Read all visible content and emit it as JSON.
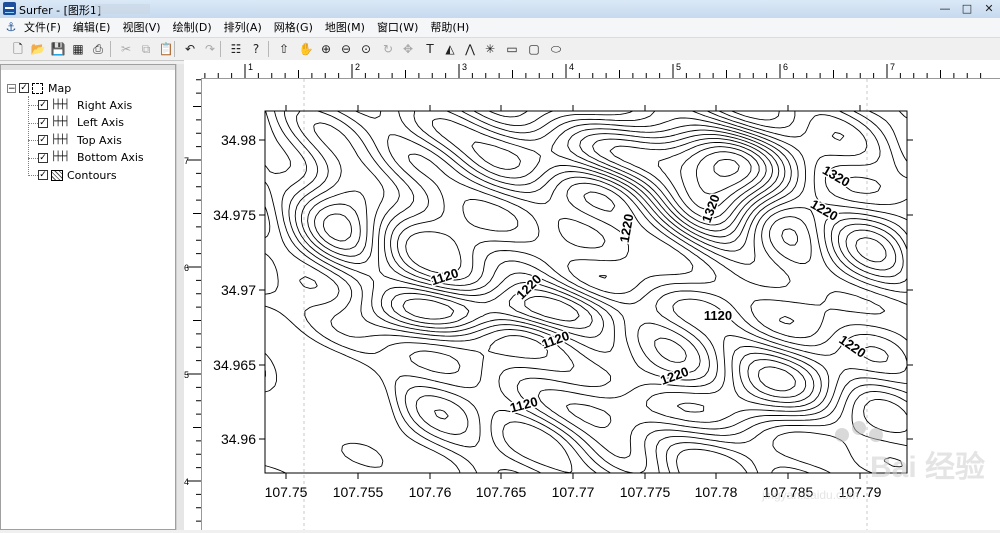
{
  "window": {
    "title": "Surfer - [图形1]"
  },
  "window_controls": {
    "minimize": "—",
    "maximize": "□",
    "close": "✕"
  },
  "menu": {
    "items": [
      {
        "label": "文件(F)"
      },
      {
        "label": "编辑(E)"
      },
      {
        "label": "视图(V)"
      },
      {
        "label": "绘制(D)"
      },
      {
        "label": "排列(A)"
      },
      {
        "label": "网格(G)"
      },
      {
        "label": "地图(M)"
      },
      {
        "label": "窗口(W)"
      },
      {
        "label": "帮助(H)"
      }
    ]
  },
  "toolbar": {
    "buttons": [
      {
        "name": "new-icon",
        "glyph": "🗋",
        "enabled": true
      },
      {
        "name": "open-icon",
        "glyph": "📂",
        "enabled": true
      },
      {
        "name": "save-icon",
        "glyph": "💾",
        "enabled": true
      },
      {
        "name": "worksheet-icon",
        "glyph": "▦",
        "enabled": true
      },
      {
        "name": "print-icon",
        "glyph": "⎙",
        "enabled": true
      },
      {
        "name": "cut-icon",
        "glyph": "✂",
        "enabled": false
      },
      {
        "name": "copy-icon",
        "glyph": "⧉",
        "enabled": false
      },
      {
        "name": "paste-icon",
        "glyph": "📋",
        "enabled": true
      },
      {
        "name": "undo-icon",
        "glyph": "↶",
        "enabled": true
      },
      {
        "name": "redo-icon",
        "glyph": "↷",
        "enabled": false
      },
      {
        "name": "object-manager-icon",
        "glyph": "☷",
        "enabled": true
      },
      {
        "name": "help-pointer-icon",
        "glyph": "?",
        "enabled": true
      },
      {
        "name": "select-arrow-icon",
        "glyph": "⇧",
        "enabled": true
      },
      {
        "name": "pan-hand-icon",
        "glyph": "✋",
        "enabled": true
      },
      {
        "name": "zoom-in-icon",
        "glyph": "⊕",
        "enabled": true
      },
      {
        "name": "zoom-out-icon",
        "glyph": "⊖",
        "enabled": true
      },
      {
        "name": "zoom-fit-icon",
        "glyph": "⊙",
        "enabled": true
      },
      {
        "name": "rotate-icon",
        "glyph": "↻",
        "enabled": false
      },
      {
        "name": "reshape-icon",
        "glyph": "✥",
        "enabled": false
      },
      {
        "name": "text-tool-icon",
        "glyph": "T",
        "enabled": true
      },
      {
        "name": "polygon-tool-icon",
        "glyph": "◭",
        "enabled": true
      },
      {
        "name": "polyline-tool-icon",
        "glyph": "⋀",
        "enabled": true
      },
      {
        "name": "symbol-tool-icon",
        "glyph": "✳",
        "enabled": true
      },
      {
        "name": "rectangle-tool-icon",
        "glyph": "▭",
        "enabled": true
      },
      {
        "name": "rounded-rectangle-tool-icon",
        "glyph": "▢",
        "enabled": true
      },
      {
        "name": "ellipse-tool-icon",
        "glyph": "⬭",
        "enabled": true
      }
    ]
  },
  "object_tree": {
    "root": {
      "label": "Map",
      "checked": true,
      "expanded": true
    },
    "children": [
      {
        "label": "Right Axis",
        "icon": "axis-icon"
      },
      {
        "label": "Left Axis",
        "icon": "axis-icon"
      },
      {
        "label": "Top Axis",
        "icon": "axis-icon"
      },
      {
        "label": "Bottom Axis",
        "icon": "axis-icon"
      },
      {
        "label": "Contours",
        "icon": "contours-icon"
      }
    ]
  },
  "rulers": {
    "horizontal_labels": [
      "1",
      "2",
      "3",
      "4",
      "5",
      "6",
      "7"
    ],
    "vertical_labels": [
      "7",
      "6",
      "5",
      "4"
    ]
  },
  "map": {
    "x_ticks": [
      "107.75",
      "107.755",
      "107.76",
      "107.765",
      "107.77",
      "107.775",
      "107.78",
      "107.785",
      "107.79"
    ],
    "y_ticks": [
      "34.98",
      "34.975",
      "34.97",
      "34.965",
      "34.96"
    ],
    "contour_labels": [
      "1120",
      "1220",
      "1220",
      "1320",
      "1320",
      "1220",
      "1120",
      "1120",
      "1220",
      "1220",
      "1120"
    ]
  },
  "watermark": {
    "text": "Bai 经验",
    "sub": "jingyan.baidu.com"
  }
}
